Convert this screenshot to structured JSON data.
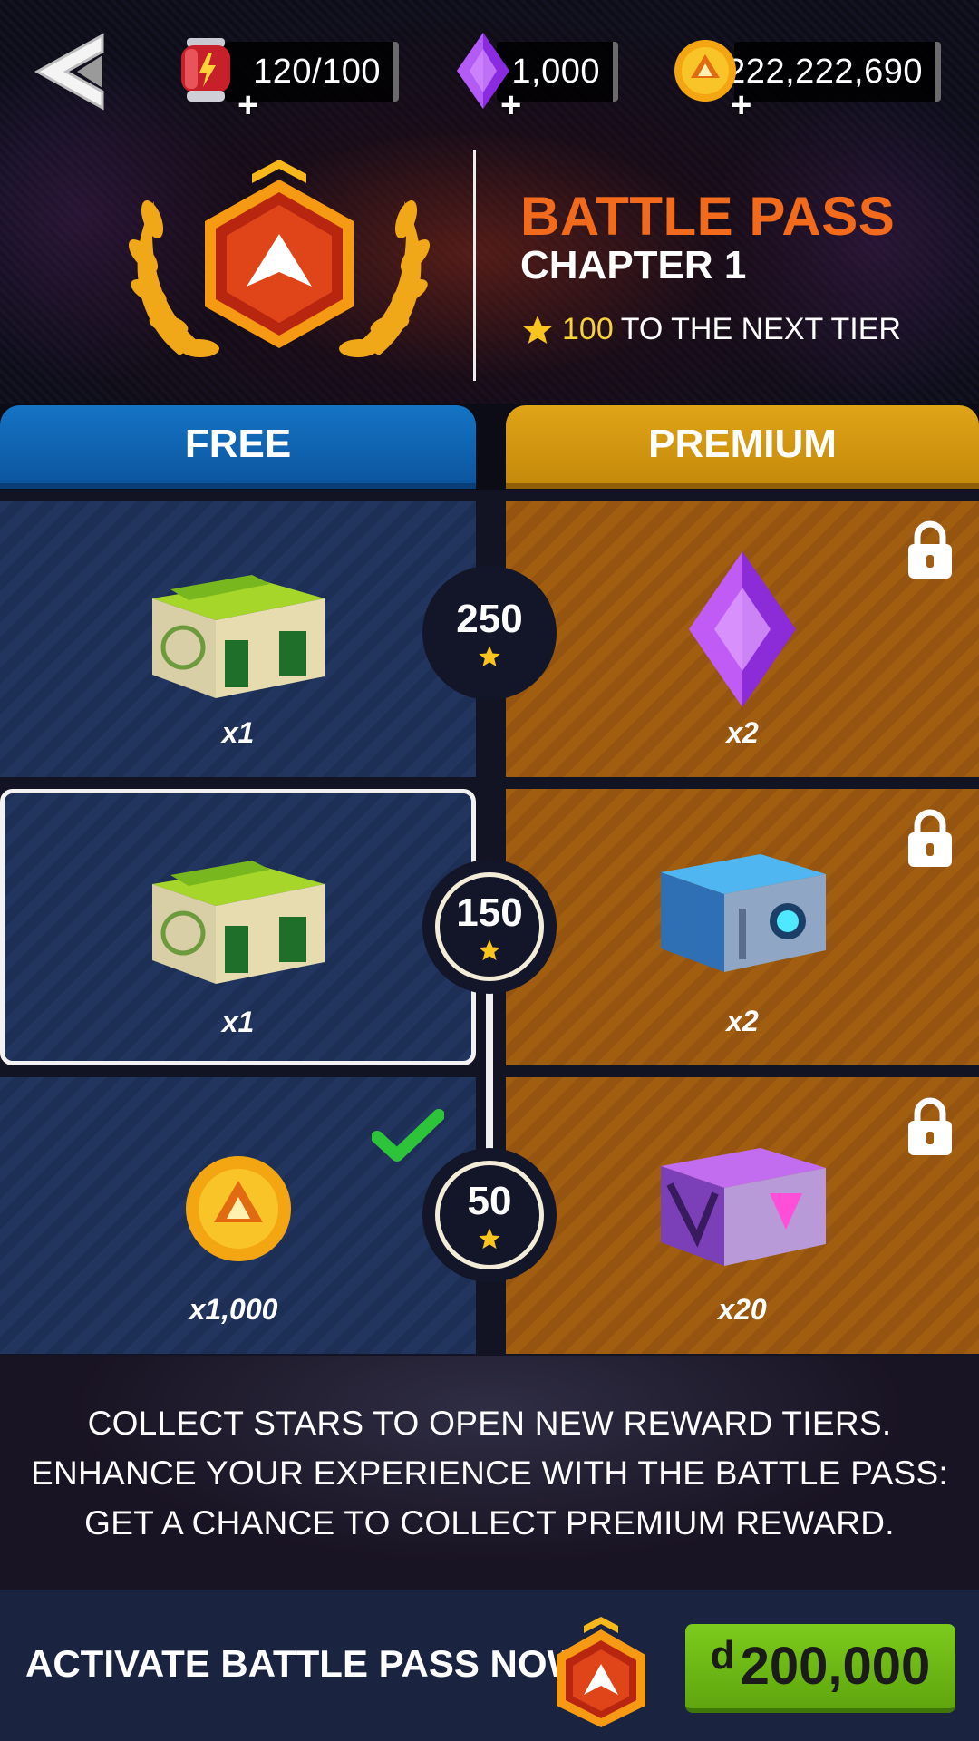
{
  "resources": {
    "energy": "120/100",
    "gems": "1,000",
    "coins": "222,222,690"
  },
  "battle_pass": {
    "title": "BATTLE PASS",
    "chapter": "CHAPTER 1",
    "next_tier_value": "100",
    "next_tier_text": "TO THE NEXT TIER"
  },
  "tabs": {
    "free": "FREE",
    "premium": "PREMIUM"
  },
  "tiers": [
    {
      "stars": "250",
      "free_reward": "green-crate",
      "free_qty": "x1",
      "premium_reward": "purple-gem",
      "premium_qty": "x2"
    },
    {
      "stars": "150",
      "free_reward": "green-crate",
      "free_qty": "x1",
      "premium_reward": "blue-crate",
      "premium_qty": "x2"
    },
    {
      "stars": "50",
      "free_reward": "gold-coin",
      "free_qty": "x1,000",
      "premium_reward": "purple-crate",
      "premium_qty": "x20"
    }
  ],
  "info": {
    "line1": "COLLECT STARS TO OPEN NEW REWARD TIERS.",
    "line2": "ENHANCE YOUR EXPERIENCE WITH THE BATTLE PASS:",
    "line3": "GET A CHANCE TO COLLECT PREMIUM REWARD."
  },
  "footer": {
    "activate_label": "ACTIVATE BATTLE PASS NOW",
    "currency_symbol": "d",
    "price": "200,000"
  },
  "colors": {
    "accent_orange": "#f26a1b",
    "free_blue": "#0c56a0",
    "premium_gold": "#c58a0b",
    "buy_green": "#6bb614"
  }
}
